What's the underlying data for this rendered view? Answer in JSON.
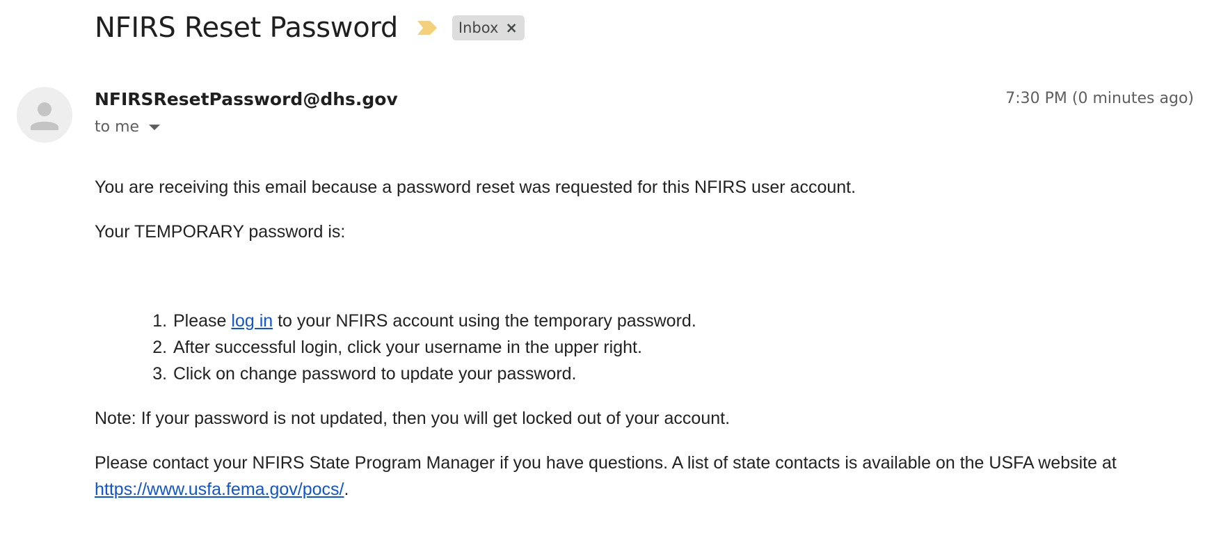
{
  "header": {
    "subject": "NFIRS Reset Password",
    "label": "Inbox",
    "label_close": "×",
    "importance_color": "#f5d07a"
  },
  "message": {
    "sender": "NFIRSResetPassword@dhs.gov",
    "recipient": "to me",
    "timestamp": "7:30 PM (0 minutes ago)"
  },
  "body": {
    "intro": "You are receiving this email because a password reset was requested for this NFIRS user account.",
    "temp_label": "Your TEMPORARY password is:",
    "steps": {
      "s1_before": "Please ",
      "s1_link": "log in",
      "s1_after": " to your NFIRS account using the temporary password.",
      "s2": "After successful login, click your username in the upper right.",
      "s3": "Click on change password to update your password."
    },
    "note": "Note: If your password is not updated, then you will get locked out of your account.",
    "contact": "Please contact your NFIRS State Program Manager if you have questions. A list of state contacts is available on the USFA website at ",
    "contact_link": "https://www.usfa.fema.gov/pocs/",
    "contact_end": "."
  },
  "colors": {
    "link": "#1155cc",
    "chip_bg": "#dddddd",
    "avatar_bg": "#eeeeee"
  }
}
